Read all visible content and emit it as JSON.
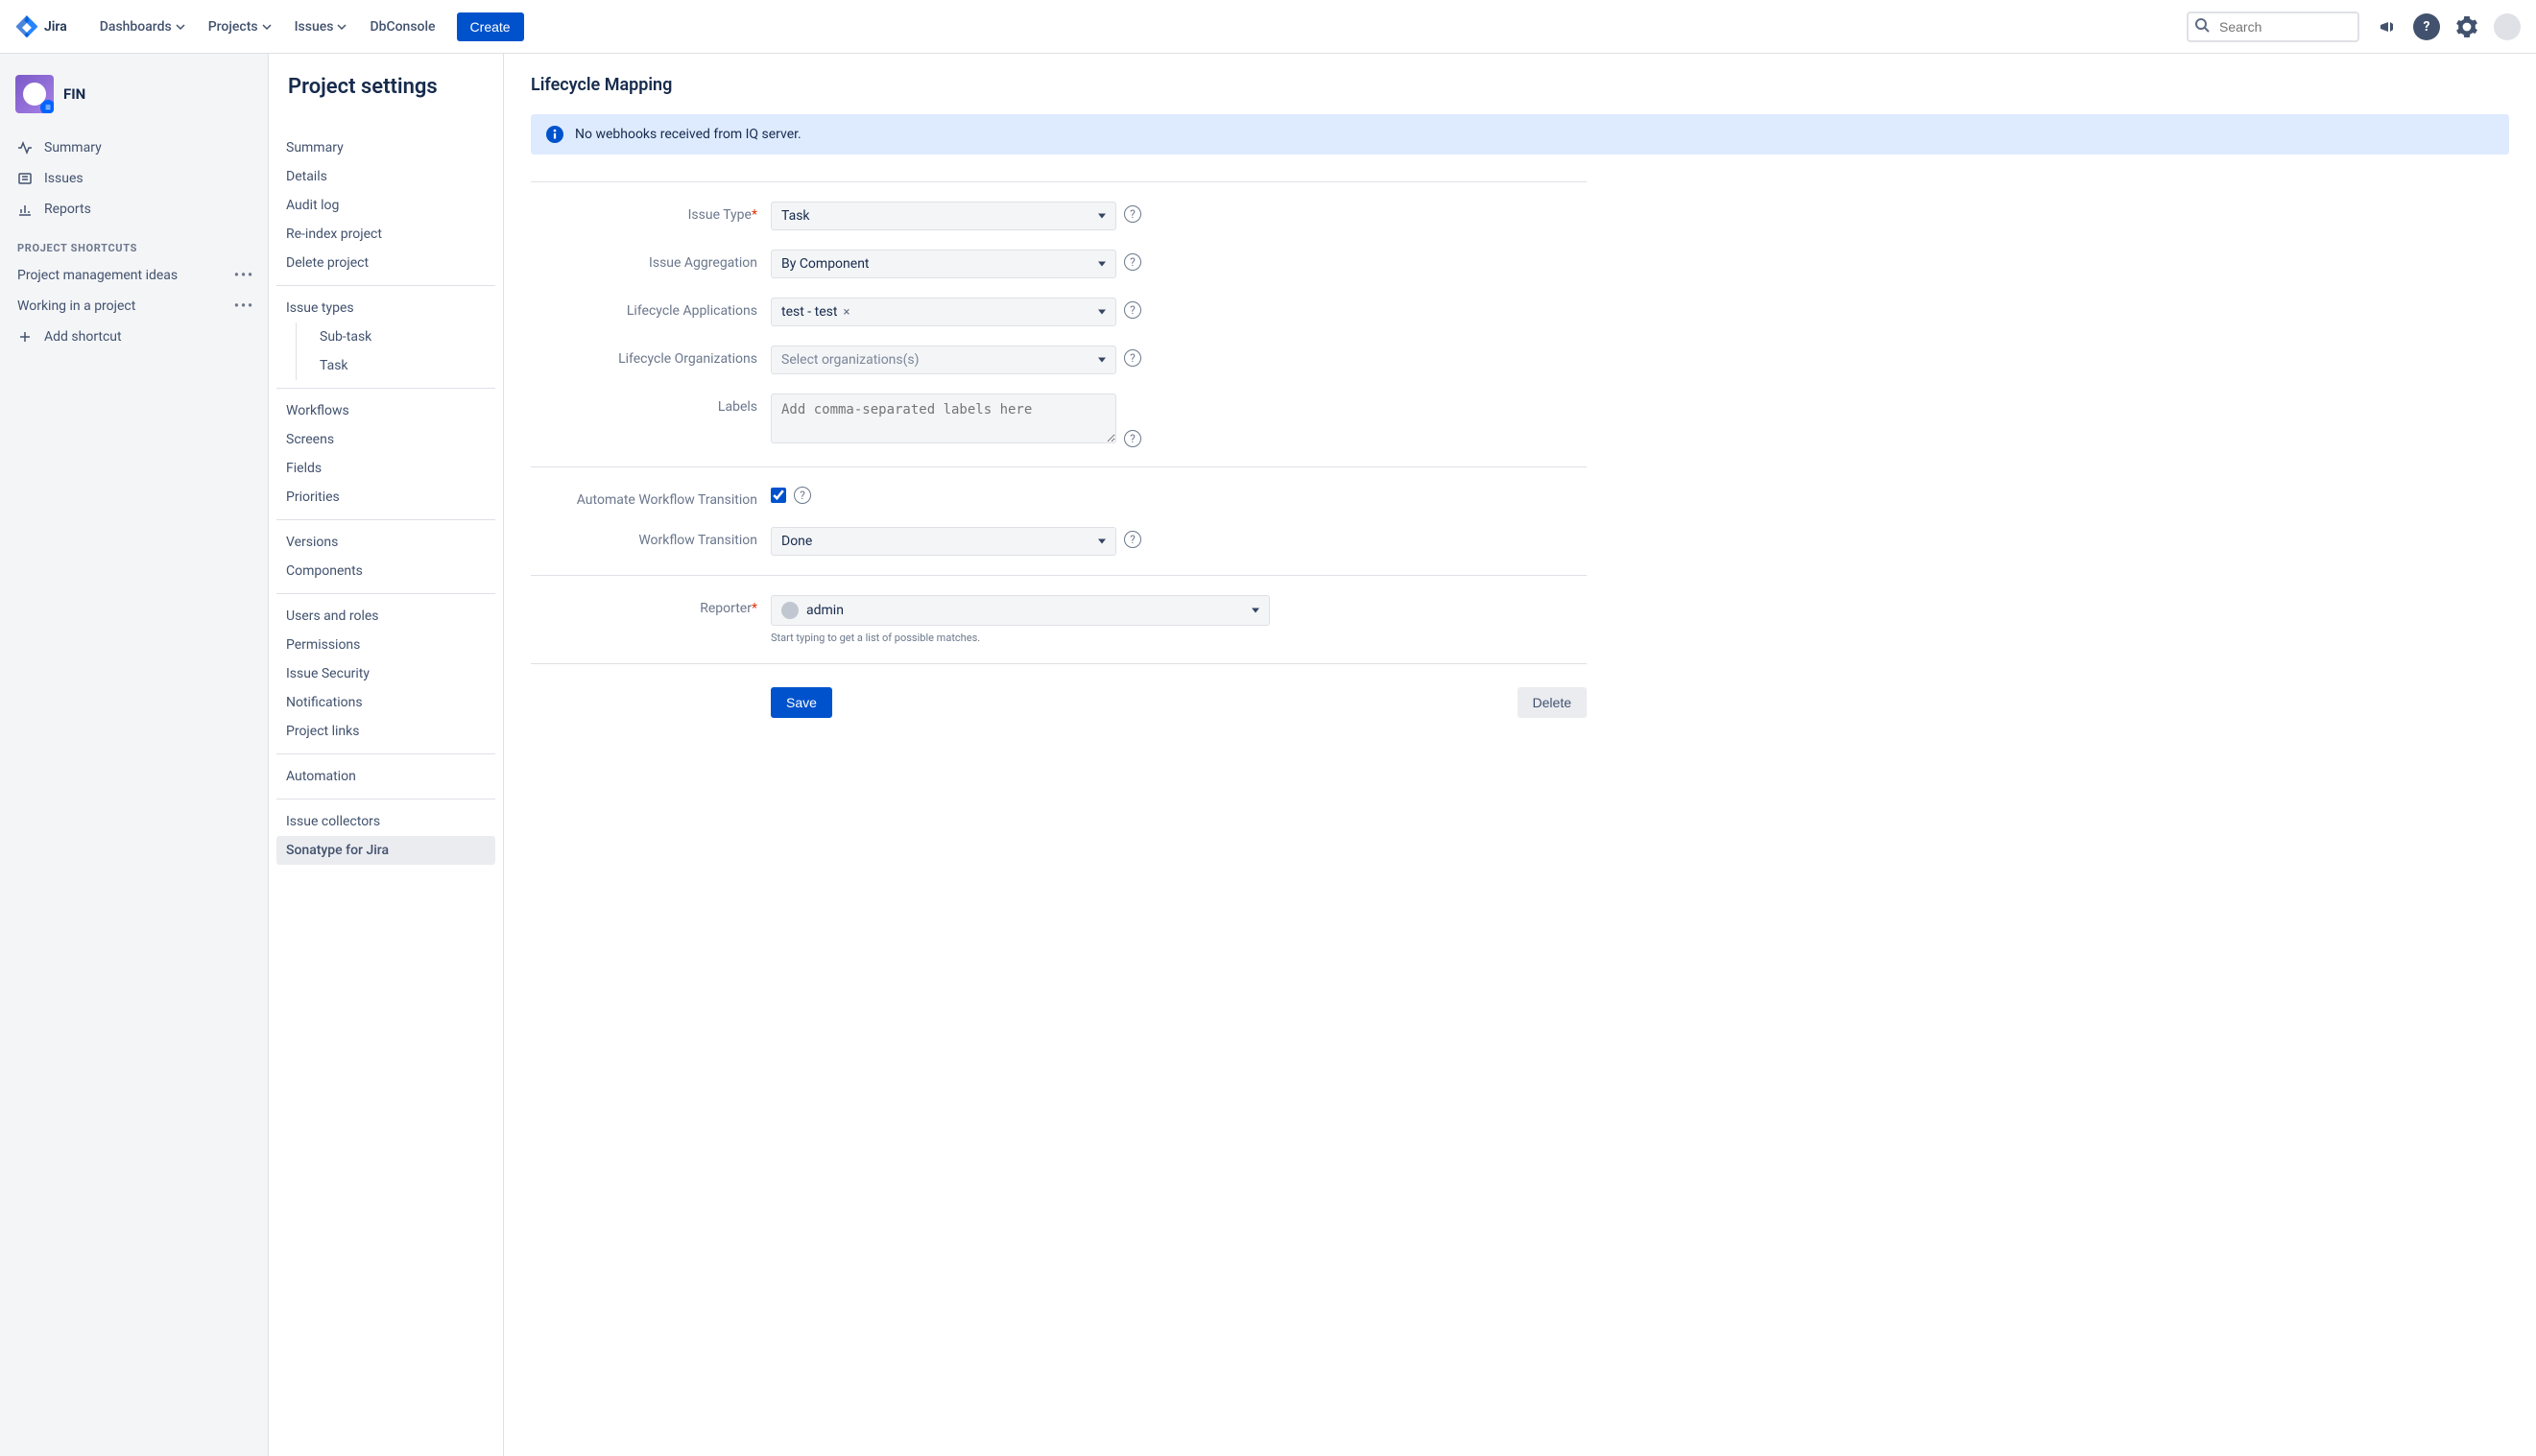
{
  "brand": "Jira",
  "topnav": {
    "items": [
      "Dashboards",
      "Projects",
      "Issues",
      "DbConsole"
    ],
    "create": "Create",
    "search_placeholder": "Search"
  },
  "sidebar": {
    "project_name": "FIN",
    "links": [
      {
        "label": "Summary",
        "icon": "pulse"
      },
      {
        "label": "Issues",
        "icon": "queue"
      },
      {
        "label": "Reports",
        "icon": "chart"
      }
    ],
    "shortcuts_head": "PROJECT SHORTCUTS",
    "shortcuts": [
      "Project management ideas",
      "Working in a project"
    ],
    "add_shortcut": "Add shortcut"
  },
  "settings": {
    "title": "Project settings",
    "groups": [
      {
        "items": [
          "Summary",
          "Details",
          "Audit log",
          "Re-index project",
          "Delete project"
        ]
      },
      {
        "head": "Issue types",
        "children": [
          "Sub-task",
          "Task"
        ]
      },
      {
        "items": [
          "Workflows",
          "Screens",
          "Fields",
          "Priorities"
        ]
      },
      {
        "items": [
          "Versions",
          "Components"
        ]
      },
      {
        "items": [
          "Users and roles",
          "Permissions",
          "Issue Security",
          "Notifications",
          "Project links"
        ]
      },
      {
        "items": [
          "Automation"
        ]
      },
      {
        "items": [
          "Issue collectors",
          "Sonatype for Jira"
        ],
        "selected": "Sonatype for Jira"
      }
    ]
  },
  "page": {
    "title": "Lifecycle Mapping",
    "banner": "No webhooks received from IQ server.",
    "fields": {
      "issue_type": {
        "label": "Issue Type",
        "value": "Task",
        "required": true
      },
      "aggregation": {
        "label": "Issue Aggregation",
        "value": "By Component"
      },
      "applications": {
        "label": "Lifecycle Applications",
        "tag": "test - test"
      },
      "organizations": {
        "label": "Lifecycle Organizations",
        "placeholder": "Select organizations(s)"
      },
      "labels": {
        "label": "Labels",
        "placeholder": "Add comma-separated labels here"
      },
      "automate": {
        "label": "Automate Workflow Transition",
        "checked": true
      },
      "transition": {
        "label": "Workflow Transition",
        "value": "Done"
      },
      "reporter": {
        "label": "Reporter",
        "value": "admin",
        "required": true,
        "hint": "Start typing to get a list of possible matches."
      }
    },
    "save": "Save",
    "delete": "Delete"
  }
}
